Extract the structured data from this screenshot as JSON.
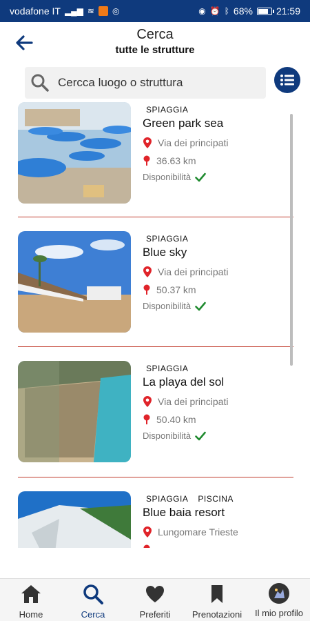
{
  "status_bar": {
    "carrier": "vodafone IT",
    "battery": "68%",
    "battery_level": 0.68,
    "time": "21:59"
  },
  "header": {
    "title": "Cerca",
    "subtitle": "tutte le strutture"
  },
  "search": {
    "placeholder": "Cercca luogo o struttura"
  },
  "results": [
    {
      "tags": [
        "SPIAGGIA"
      ],
      "name": "Green park sea",
      "address": "Via dei principati",
      "distance": "36.63 km",
      "availability": "Disponibilità",
      "available": true
    },
    {
      "tags": [
        "SPIAGGIA"
      ],
      "name": "Blue sky",
      "address": "Via dei principati",
      "distance": "50.37 km",
      "availability": "Disponibilità",
      "available": true
    },
    {
      "tags": [
        "SPIAGGIA"
      ],
      "name": "La playa del sol",
      "address": "Via dei principati",
      "distance": "50.40 km",
      "availability": "Disponibilità",
      "available": true
    },
    {
      "tags": [
        "SPIAGGIA",
        "PISCINA"
      ],
      "name": "Blue baia resort",
      "address": "Lungomare Trieste",
      "distance": "",
      "availability": "",
      "available": false
    }
  ],
  "tabs": [
    {
      "label": "Home",
      "icon": "home-icon",
      "active": false
    },
    {
      "label": "Cerca",
      "icon": "search-icon",
      "active": true
    },
    {
      "label": "Preferiti",
      "icon": "heart-icon",
      "active": false
    },
    {
      "label": "Prenotazioni",
      "icon": "bookmark-icon",
      "active": false
    },
    {
      "label": "Il mio profilo",
      "icon": "avatar-icon",
      "active": false
    }
  ],
  "colors": {
    "brand": "#0f3a7d",
    "divider": "#c0392b",
    "pin": "#e0242a",
    "check": "#1e8a2e"
  }
}
